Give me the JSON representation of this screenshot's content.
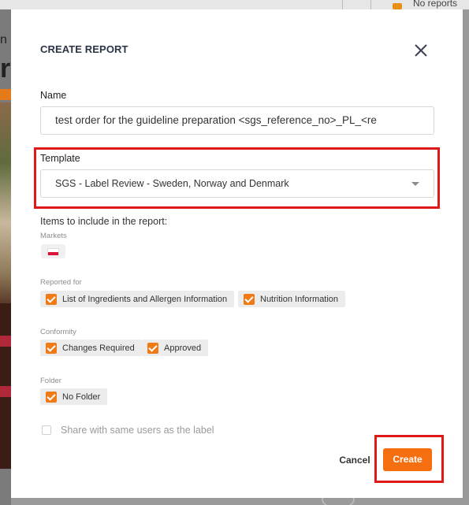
{
  "background": {
    "header_status": "No reports",
    "left_fragment_1": "n",
    "left_fragment_2": "r"
  },
  "modal": {
    "title": "CREATE REPORT",
    "close_icon": "close-icon",
    "name": {
      "label": "Name",
      "value": "test order for the guideline preparation  <sgs_reference_no>_PL_<re"
    },
    "template": {
      "label": "Template",
      "selected": "SGS - Label Review - Sweden, Norway and Denmark",
      "caret_icon": "caret-down-icon"
    },
    "items_label": "Items to include in the report:",
    "markets": {
      "label": "Markets",
      "flag_icon": "poland-flag-icon"
    },
    "reported_for": {
      "label": "Reported for",
      "options": [
        {
          "label": "List of Ingredients and Allergen Information",
          "checked": true
        },
        {
          "label": "Nutrition Information",
          "checked": true
        }
      ]
    },
    "conformity": {
      "label": "Conformity",
      "options": [
        {
          "label": "Changes Required",
          "checked": true
        },
        {
          "label": "Approved",
          "checked": true
        }
      ]
    },
    "folder": {
      "label": "Folder",
      "options": [
        {
          "label": "No Folder",
          "checked": true
        }
      ]
    },
    "share": {
      "label": "Share with same users as the label",
      "checked": false
    },
    "buttons": {
      "cancel": "Cancel",
      "create": "Create"
    }
  },
  "colors": {
    "accent": "#f56e0f",
    "checkbox": "#f07a14",
    "highlight": "#e01818"
  }
}
